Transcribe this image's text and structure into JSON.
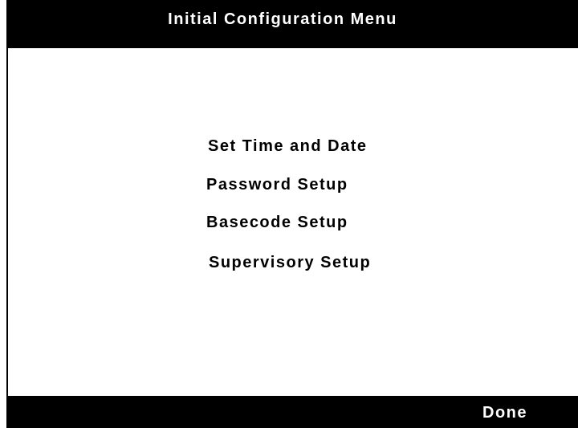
{
  "header": {
    "title": "Initial Configuration Menu"
  },
  "menu": {
    "items": [
      {
        "label": "Set Time and Date"
      },
      {
        "label": "Password Setup"
      },
      {
        "label": "Basecode Setup"
      },
      {
        "label": "Supervisory Setup"
      }
    ]
  },
  "footer": {
    "done_label": "Done"
  },
  "colors": {
    "bar_background": "#000000",
    "bar_text": "#ffffff",
    "panel_background": "#ffffff",
    "menu_text": "#000000"
  }
}
